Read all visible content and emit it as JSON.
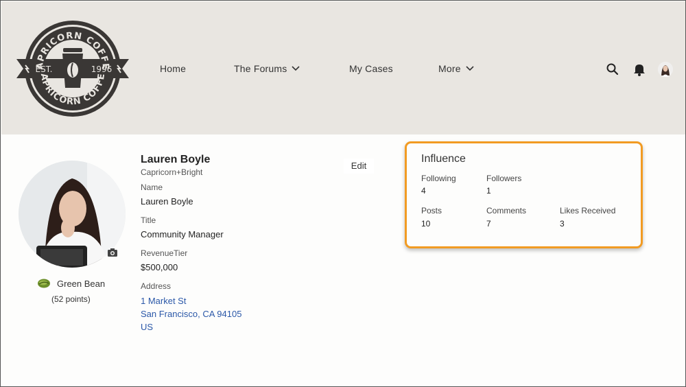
{
  "brand": {
    "logo_top": "CAPRICORN COFFEE",
    "logo_bottom": "CAPRICORN COFFEE",
    "est": "EST.",
    "year": "1996"
  },
  "nav": {
    "home": "Home",
    "forums": "The Forums",
    "cases": "My Cases",
    "more": "More"
  },
  "icons": {
    "search": "search-icon",
    "notifications": "bell-icon",
    "avatar": "user-avatar"
  },
  "profile": {
    "name": "Lauren Boyle",
    "company": "Capricorn+Bright",
    "edit_label": "Edit",
    "badge": "Green Bean",
    "points": "(52 points)",
    "fields": {
      "name_label": "Name",
      "name_value": "Lauren Boyle",
      "title_label": "Title",
      "title_value": "Community Manager",
      "revenue_label": "RevenueTier",
      "revenue_value": "$500,000",
      "address_label": "Address",
      "address_line1": "1 Market St",
      "address_line2": "San Francisco, CA 94105",
      "address_line3": "US"
    }
  },
  "influence": {
    "title": "Influence",
    "following_label": "Following",
    "following": "4",
    "followers_label": "Followers",
    "followers": "1",
    "posts_label": "Posts",
    "posts": "10",
    "comments_label": "Comments",
    "comments": "7",
    "likes_label": "Likes Received",
    "likes": "3"
  },
  "colors": {
    "header_bg": "#e9e6e1",
    "highlight": "#f29b22",
    "link": "#2b58a8",
    "logo_dark": "#3a3735"
  }
}
